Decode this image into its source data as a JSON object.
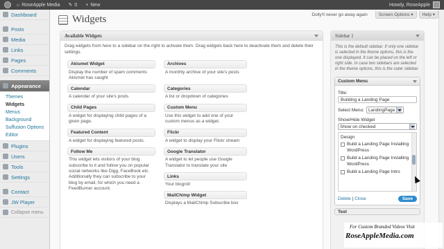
{
  "adminbar": {
    "site": "RoseApple Media",
    "comments": "0",
    "new": "New",
    "greeting": "Howdy, RoseApple"
  },
  "menu": {
    "items": [
      {
        "label": "Dashboard",
        "icon": "dashboard-icon"
      },
      {
        "label": "Posts",
        "icon": "pin-icon"
      },
      {
        "label": "Media",
        "icon": "media-icon"
      },
      {
        "label": "Links",
        "icon": "link-icon"
      },
      {
        "label": "Pages",
        "icon": "pages-icon"
      },
      {
        "label": "Comments",
        "icon": "comment-icon"
      },
      {
        "label": "Appearance",
        "icon": "appearance-icon"
      }
    ],
    "appearance_sub": [
      "Themes",
      "Widgets",
      "Menus",
      "Background",
      "Suffusion Options",
      "Editor"
    ],
    "lower_items": [
      {
        "label": "Plugins",
        "icon": "plugin-icon"
      },
      {
        "label": "Users",
        "icon": "users-icon"
      },
      {
        "label": "Tools",
        "icon": "tools-icon"
      },
      {
        "label": "Settings",
        "icon": "settings-icon"
      },
      {
        "label": "Contact",
        "icon": "contact-icon"
      },
      {
        "label": "JW Player",
        "icon": "player-icon"
      }
    ],
    "collapse": "Collapse menu"
  },
  "header": {
    "title": "Widgets",
    "notice": "Dolly'll never go away again",
    "screen_options": "Screen Options ▾",
    "help": "Help ▾"
  },
  "available": {
    "title": "Available Widgets",
    "description": "Drag widgets from here to a sidebar on the right to activate them. Drag widgets back here to deactivate them and delete their settings.",
    "widgets": [
      {
        "name": "Akismet Widget",
        "desc": "Display the number of spam comments Akismet has caught"
      },
      {
        "name": "Archives",
        "desc": "A monthly archive of your site's posts"
      },
      {
        "name": "Calendar",
        "desc": "A calendar of your site's posts"
      },
      {
        "name": "Categories",
        "desc": "A list or dropdown of categories"
      },
      {
        "name": "Child Pages",
        "desc": "A widget for displaying child pages of a given page."
      },
      {
        "name": "Custom Menu",
        "desc": "Use this widget to add one of your custom menus as a widget."
      },
      {
        "name": "Featured Content",
        "desc": "A widget for displaying featured posts."
      },
      {
        "name": "Flickr",
        "desc": "A widget to display your Flickr stream"
      },
      {
        "name": "Follow Me",
        "desc": "This widget lets visitors of your blog subscribe to it and follow you on popular social networks like Digg, FaceBook etc. Additionally they can subscribe to your blog by email, for which you need a FeedBurner account."
      },
      {
        "name": "Google Translator",
        "desc": "A widget to let people use Google Translator to translate your site"
      },
      {
        "name": "",
        "desc": ""
      },
      {
        "name": "Links",
        "desc": "Your blogroll"
      },
      {
        "name": "",
        "desc": ""
      },
      {
        "name": "MailChimp Widget",
        "desc": "Displays a MailChimp Subscribe box"
      }
    ]
  },
  "sidebar1": {
    "title": "Sidebar 1",
    "description": "This is the default sidebar. If only one sidebar is selected in the theme options, this is the one displayed. It can be placed on the left or right side. In case two sidebars are selected in the theme options, this is the outer sidebar.",
    "widget": {
      "title": "Custom Menu",
      "title_label": "Title:",
      "title_value": "Building a Landing Page",
      "select_menu_label": "Select Menu:",
      "select_menu_value": "LandingPage",
      "showhide_label": "Show/Hide Widget",
      "showhide_value": "Show on checked",
      "list_header": "Design",
      "list_items": [
        "Build a Landing Page Installing WordPress",
        "Build a Landing Page Installing WordPress",
        "Build a Landing Page Intro"
      ],
      "delete": "Delete",
      "sep": "|",
      "close": "Close",
      "save": "Save"
    },
    "next_widget": "Text"
  },
  "watermark": {
    "line1": "For Custom Branded Videos Visit",
    "line2": "RoseAppleMedia.com"
  }
}
